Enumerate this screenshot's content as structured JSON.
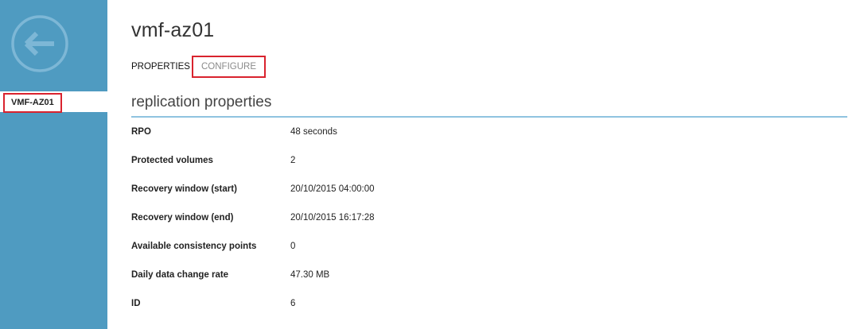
{
  "sidebar": {
    "back_icon": "back-arrow-icon",
    "item": {
      "label": "VMF-AZ01"
    }
  },
  "header": {
    "title": "vmf-az01"
  },
  "tabs": [
    {
      "label": "PROPERTIES",
      "active": true
    },
    {
      "label": "CONFIGURE",
      "active": false
    }
  ],
  "section": {
    "title": "replication properties"
  },
  "properties": [
    {
      "label": "RPO",
      "value": "48 seconds"
    },
    {
      "label": "Protected volumes",
      "value": "2"
    },
    {
      "label": "Recovery window (start)",
      "value": "20/10/2015 04:00:00"
    },
    {
      "label": "Recovery window (end)",
      "value": "20/10/2015 16:17:28"
    },
    {
      "label": "Available consistency points",
      "value": "0"
    },
    {
      "label": "Daily data change rate",
      "value": "47.30 MB"
    },
    {
      "label": "ID",
      "value": "6"
    }
  ],
  "colors": {
    "sidebar": "#4f9bc1",
    "highlight_border": "#d9232e",
    "section_rule": "#8fc3e0"
  }
}
